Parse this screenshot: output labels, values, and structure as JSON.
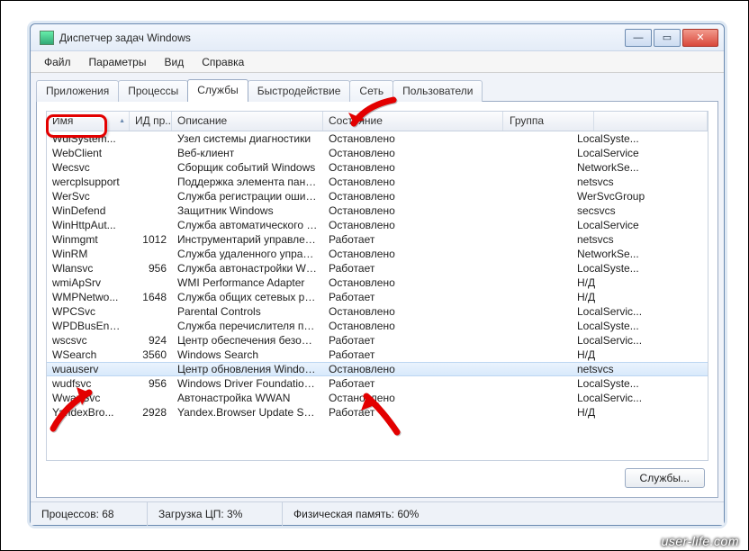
{
  "window": {
    "title": "Диспетчер задач Windows"
  },
  "menu": {
    "file": "Файл",
    "params": "Параметры",
    "view": "Вид",
    "help": "Справка"
  },
  "tabs": {
    "apps": "Приложения",
    "proc": "Процессы",
    "svc": "Службы",
    "perf": "Быстродействие",
    "net": "Сеть",
    "users": "Пользователи"
  },
  "cols": {
    "name": "Имя",
    "pid": "ИД пр...",
    "desc": "Описание",
    "state": "Состояние",
    "group": "Группа"
  },
  "btn_services": "Службы...",
  "status": {
    "proc": "Процессов: 68",
    "cpu": "Загрузка ЦП: 3%",
    "mem": "Физическая память: 60%"
  },
  "footer": "user-life.com",
  "rows": [
    {
      "name": "WdiSystem...",
      "pid": "",
      "desc": "Узел системы диагностики",
      "state": "Остановлено",
      "group": "LocalSyste..."
    },
    {
      "name": "WebClient",
      "pid": "",
      "desc": "Веб-клиент",
      "state": "Остановлено",
      "group": "LocalService"
    },
    {
      "name": "Wecsvc",
      "pid": "",
      "desc": "Сборщик событий Windows",
      "state": "Остановлено",
      "group": "NetworkSe..."
    },
    {
      "name": "wercplsupport",
      "pid": "",
      "desc": "Поддержка элемента панел...",
      "state": "Остановлено",
      "group": "netsvcs"
    },
    {
      "name": "WerSvc",
      "pid": "",
      "desc": "Служба регистрации ошибо...",
      "state": "Остановлено",
      "group": "WerSvcGroup"
    },
    {
      "name": "WinDefend",
      "pid": "",
      "desc": "Защитник Windows",
      "state": "Остановлено",
      "group": "secsvcs"
    },
    {
      "name": "WinHttpAut...",
      "pid": "",
      "desc": "Служба автоматического о...",
      "state": "Остановлено",
      "group": "LocalService"
    },
    {
      "name": "Winmgmt",
      "pid": "1012",
      "desc": "Инструментарий управлени...",
      "state": "Работает",
      "group": "netsvcs"
    },
    {
      "name": "WinRM",
      "pid": "",
      "desc": "Служба удаленного управл...",
      "state": "Остановлено",
      "group": "NetworkSe..."
    },
    {
      "name": "Wlansvc",
      "pid": "956",
      "desc": "Служба автонастройки WLAN",
      "state": "Работает",
      "group": "LocalSyste..."
    },
    {
      "name": "wmiApSrv",
      "pid": "",
      "desc": "WMI Performance Adapter",
      "state": "Остановлено",
      "group": "Н/Д"
    },
    {
      "name": "WMPNetwo...",
      "pid": "1648",
      "desc": "Служба общих сетевых рес...",
      "state": "Работает",
      "group": "Н/Д"
    },
    {
      "name": "WPCSvc",
      "pid": "",
      "desc": "Parental Controls",
      "state": "Остановлено",
      "group": "LocalServic..."
    },
    {
      "name": "WPDBusEnum",
      "pid": "",
      "desc": "Служба перечислителя пер...",
      "state": "Остановлено",
      "group": "LocalSyste..."
    },
    {
      "name": "wscsvc",
      "pid": "924",
      "desc": "Центр обеспечения безопа...",
      "state": "Работает",
      "group": "LocalServic..."
    },
    {
      "name": "WSearch",
      "pid": "3560",
      "desc": "Windows Search",
      "state": "Работает",
      "group": "Н/Д"
    },
    {
      "name": "wuauserv",
      "pid": "",
      "desc": "Центр обновления Windows",
      "state": "Остановлено",
      "group": "netsvcs",
      "sel": true
    },
    {
      "name": "wudfsvc",
      "pid": "956",
      "desc": "Windows Driver Foundation - ...",
      "state": "Работает",
      "group": "LocalSyste..."
    },
    {
      "name": "WwanSvc",
      "pid": "",
      "desc": "Автонастройка WWAN",
      "state": "Остановлено",
      "group": "LocalServic..."
    },
    {
      "name": "YandexBro...",
      "pid": "2928",
      "desc": "Yandex.Browser Update Serv...",
      "state": "Работает",
      "group": "Н/Д"
    }
  ]
}
